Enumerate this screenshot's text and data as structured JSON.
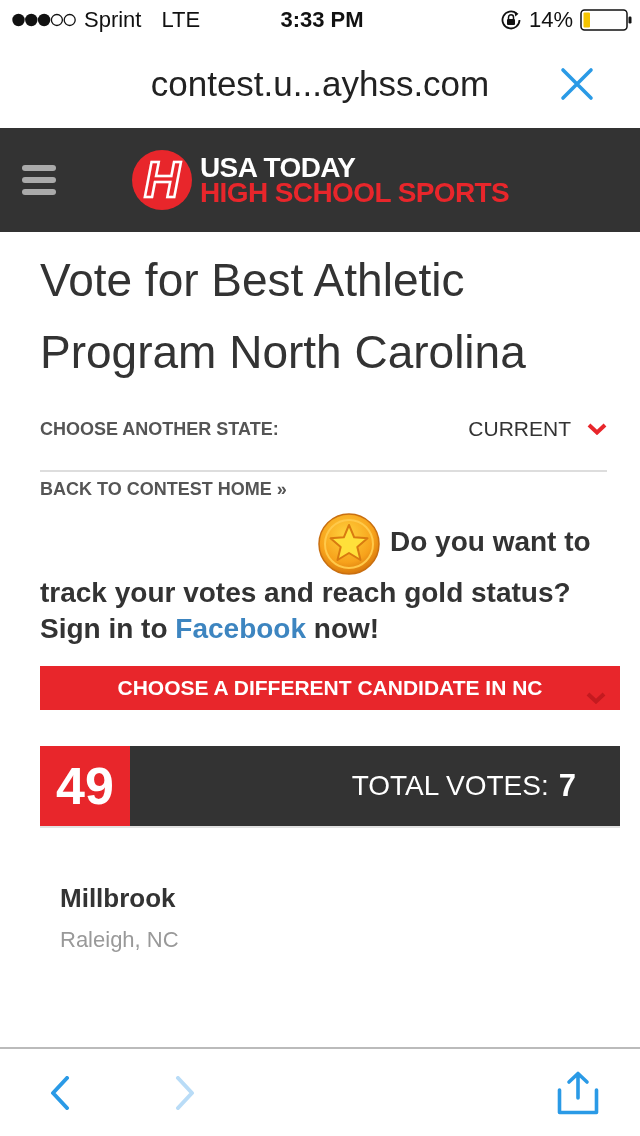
{
  "status_bar": {
    "carrier": "Sprint",
    "network": "LTE",
    "time": "3:33 PM",
    "battery": "14%"
  },
  "url_bar": {
    "url": "contest.u...ayhss.com"
  },
  "header": {
    "logo_mark": "H",
    "logo_line_1": "USA TODAY",
    "logo_line_2": "HIGH SCHOOL SPORTS"
  },
  "title": "Vote for Best Athletic Program North Carolina",
  "state_picker": {
    "label": "CHOOSE ANOTHER STATE:",
    "value": "CURRENT"
  },
  "back_link": "BACK TO CONTEST HOME »",
  "promo": {
    "text": "Do you want to track your votes and reach gold status? Sign in to",
    "link": "Facebook",
    "text_end": "now!"
  },
  "candidate_button": "CHOOSE A DIFFERENT CANDIDATE IN NC",
  "score": {
    "rank": "49",
    "label": "TOTAL VOTES:",
    "votes": "7"
  },
  "candidate": {
    "name": "Millbrook",
    "location": "Raleigh, NC"
  },
  "toolbar": {
    "buttons": [
      {
        "kind": "back",
        "disabled": false
      },
      {
        "kind": "forward",
        "disabled": true
      },
      {
        "kind": "share",
        "disabled": false
      }
    ]
  }
}
